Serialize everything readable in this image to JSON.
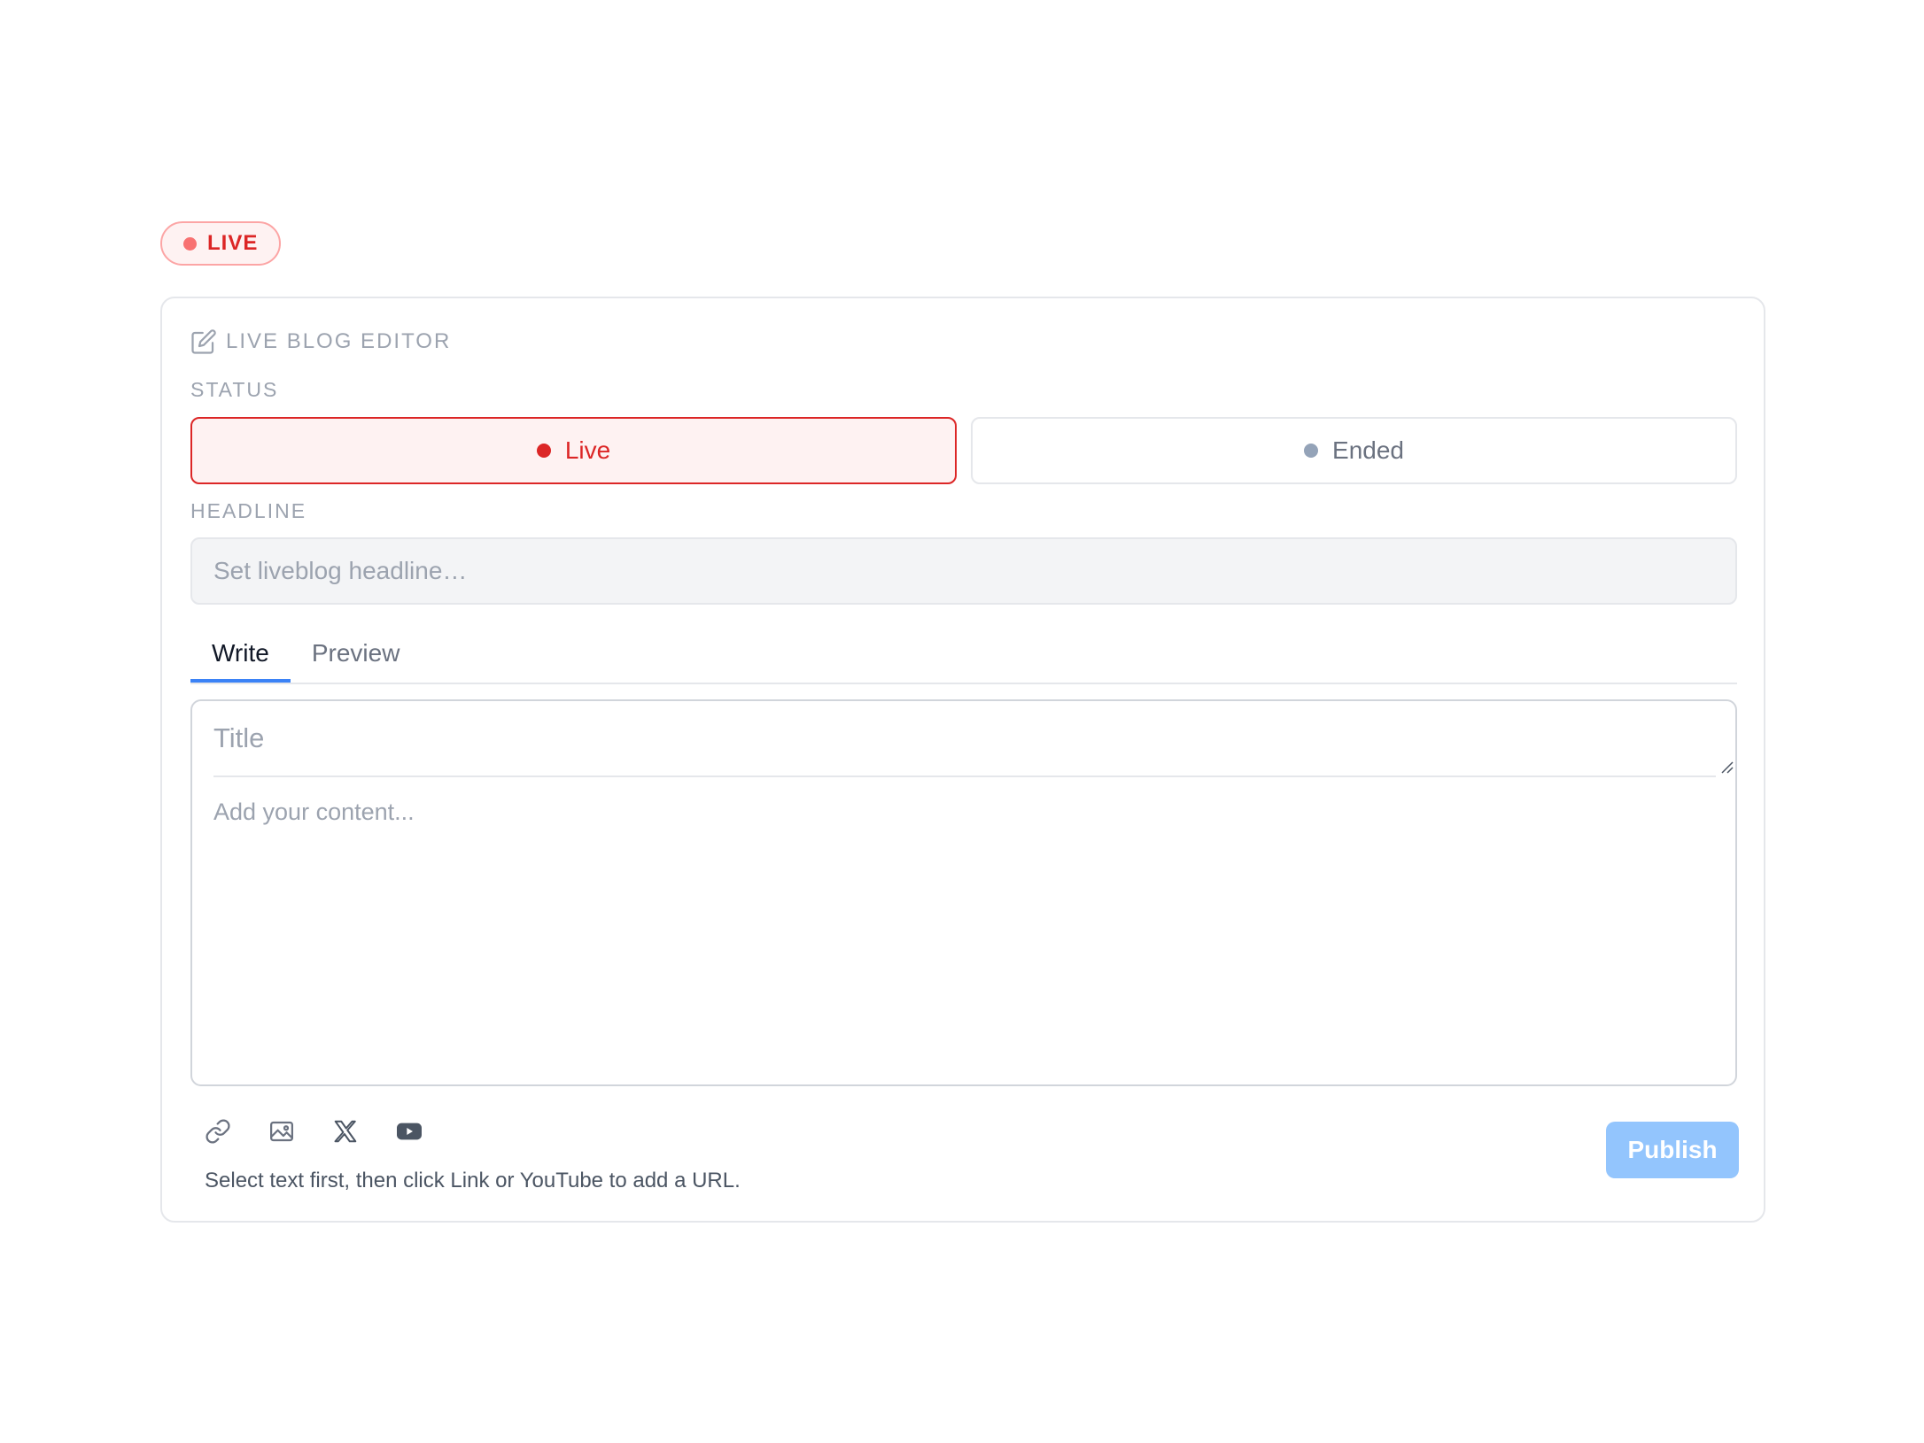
{
  "badge": {
    "label": "LIVE",
    "color": "#dc2626"
  },
  "editor": {
    "title": "LIVE BLOG EDITOR",
    "title_icon": "edit-icon",
    "status": {
      "label": "STATUS",
      "options": [
        {
          "label": "Live",
          "selected": true,
          "color": "#dc2626"
        },
        {
          "label": "Ended",
          "selected": false,
          "color": "#94a3b8"
        }
      ]
    },
    "headline": {
      "label": "HEADLINE",
      "placeholder": "Set liveblog headline…",
      "value": ""
    },
    "tabs": [
      {
        "label": "Write",
        "active": true
      },
      {
        "label": "Preview",
        "active": false
      }
    ],
    "post": {
      "title_placeholder": "Title",
      "content_placeholder": "Add your content..."
    },
    "toolbar": [
      {
        "icon": "link-icon"
      },
      {
        "icon": "image-icon"
      },
      {
        "icon": "x-logo-icon"
      },
      {
        "icon": "youtube-icon"
      }
    ],
    "hint": "Select text first, then click Link or YouTube to add a URL.",
    "publish_label": "Publish",
    "accent_color": "#3b82f6"
  }
}
